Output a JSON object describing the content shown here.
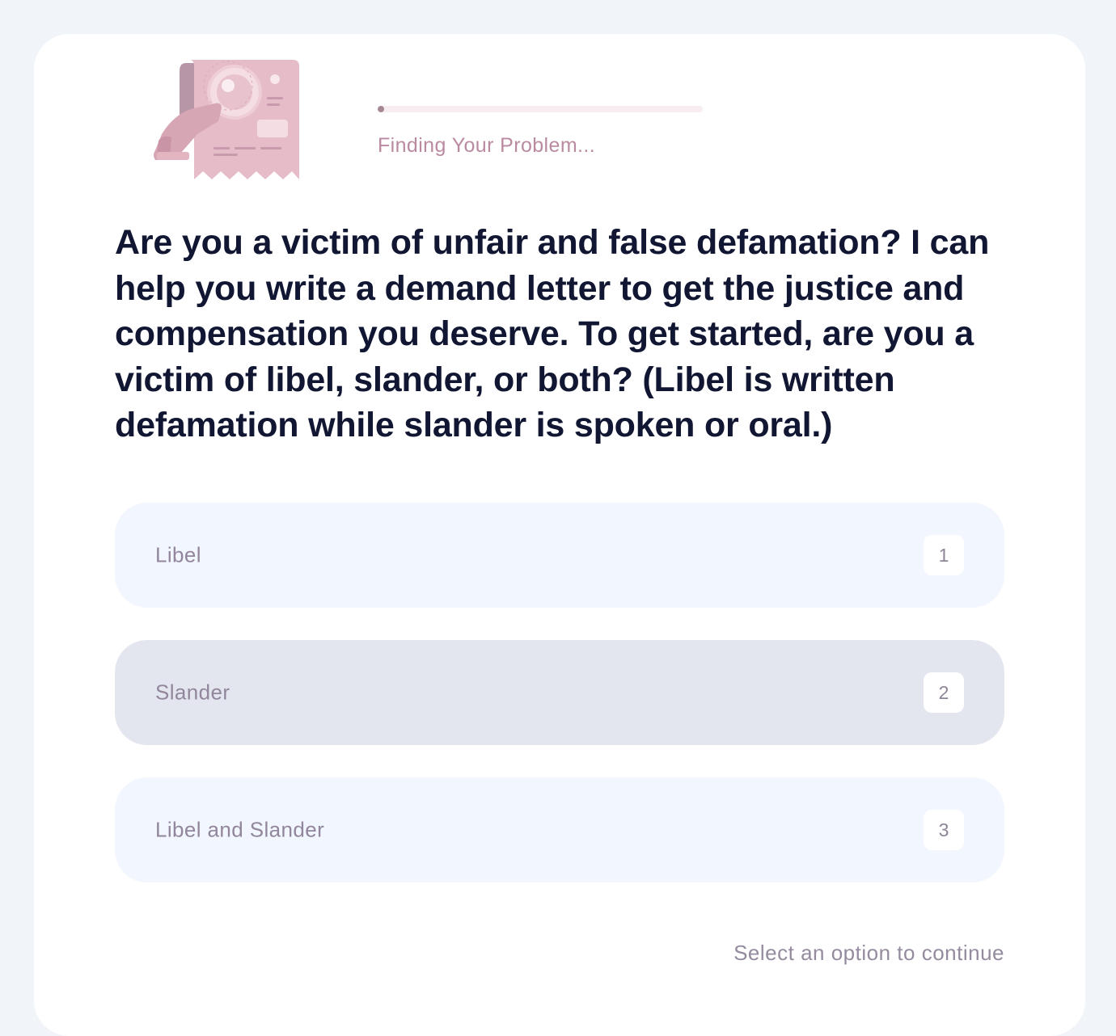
{
  "progress": {
    "label": "Finding Your Problem...",
    "percent": 2
  },
  "illustration": {
    "icon": "document-magnifier-icon"
  },
  "question": {
    "text": "Are you a victim of unfair and false defamation? I can help you write a demand letter to get the justice and compensation you deserve. To get started, are you a victim of libel, slander, or both? (Libel is written defamation while slander is spoken or oral.)"
  },
  "options": [
    {
      "label": "Libel",
      "key": "1"
    },
    {
      "label": "Slander",
      "key": "2"
    },
    {
      "label": "Libel and Slander",
      "key": "3"
    }
  ],
  "footer": {
    "hint": "Select an option to continue"
  },
  "colors": {
    "background": "#f1f4f9",
    "card": "#ffffff",
    "accent_pink": "#e3b8c4",
    "question_text": "#111632",
    "option_bg": "#f2f6fe",
    "option_hover_bg": "#e3e6ef"
  }
}
